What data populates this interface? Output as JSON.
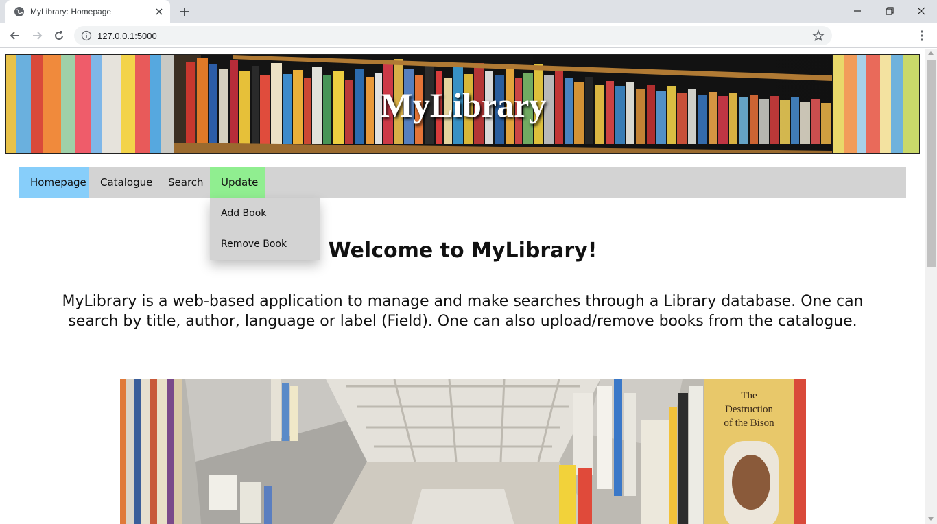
{
  "browser": {
    "tab_title": "MyLibrary: Homepage",
    "url": "127.0.0.1:5000"
  },
  "banner": {
    "title": "MyLibrary"
  },
  "nav": {
    "items": [
      {
        "label": "Homepage",
        "color": "#87cefa"
      },
      {
        "label": "Catalogue"
      },
      {
        "label": "Search"
      },
      {
        "label": "Update",
        "color": "#90ee90"
      }
    ],
    "dropdown": [
      {
        "label": "Add Book"
      },
      {
        "label": "Remove Book"
      }
    ]
  },
  "main": {
    "heading": "Welcome to MyLibrary!",
    "intro": "MyLibrary is a web-based application to manage and make searches through a Library database. One can search by title, author, language or label (Field). One can also upload/remove books from the catalogue.",
    "photo_sign": "The Destruction of the Bison"
  }
}
